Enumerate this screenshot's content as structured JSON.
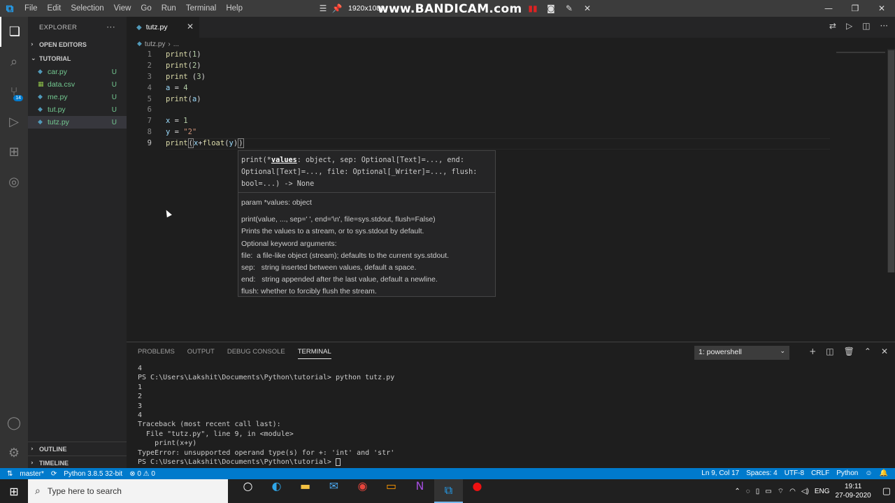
{
  "titlebar": {
    "menu": [
      "File",
      "Edit",
      "Selection",
      "View",
      "Go",
      "Run",
      "Terminal",
      "Help"
    ],
    "recorder_resolution": "1920x1080",
    "recorder_brand": "www.BANDICAM.com"
  },
  "activity_bar": {
    "scm_badge": "14"
  },
  "sidebar": {
    "title": "EXPLORER",
    "open_editors": "OPEN EDITORS",
    "folder": "TUTORIAL",
    "files": [
      {
        "name": "car.py",
        "status": "U",
        "icon": "python-icon"
      },
      {
        "name": "data.csv",
        "status": "U",
        "icon": "csv-icon"
      },
      {
        "name": "me.py",
        "status": "U",
        "icon": "python-icon"
      },
      {
        "name": "tut.py",
        "status": "U",
        "icon": "python-icon"
      },
      {
        "name": "tutz.py",
        "status": "U",
        "icon": "python-icon"
      }
    ],
    "outline": "OUTLINE",
    "timeline": "TIMELINE"
  },
  "editor": {
    "tab_label": "tutz.py",
    "breadcrumb_file": "tutz.py",
    "breadcrumb_more": "...",
    "line_numbers": [
      "1",
      "2",
      "3",
      "4",
      "5",
      "6",
      "7",
      "8",
      "9"
    ],
    "lines": [
      "print(1)",
      "print(2)",
      "print (3)",
      "a = 4",
      "print(a)",
      "",
      "x = 1",
      "y = \"2\"",
      "print(x+float(y))"
    ]
  },
  "hover": {
    "sig_start": "print(*",
    "sig_param": "values",
    "sig_rest": ": object, sep: Optional[Text]=..., end:\nOptional[Text]=..., file: Optional[_Writer]=..., flush:\nbool=...) -> None",
    "param": "param *values: object",
    "doc": [
      "print(value, ..., sep=' ', end='\\n', file=sys.stdout, flush=False)",
      "Prints the values to a stream, or to sys.stdout by default.",
      "Optional keyword arguments:",
      "file:  a file-like object (stream); defaults to the current sys.stdout.",
      "sep:   string inserted between values, default a space.",
      "end:   string appended after the last value, default a newline.",
      "flush: whether to forcibly flush the stream."
    ]
  },
  "panel": {
    "tabs": [
      "PROBLEMS",
      "OUTPUT",
      "DEBUG CONSOLE",
      "TERMINAL"
    ],
    "shell": "1: powershell",
    "terminal": "4\nPS C:\\Users\\Lakshit\\Documents\\Python\\tutorial> python tutz.py\n1\n2\n3\n4\nTraceback (most recent call last):\n  File \"tutz.py\", line 9, in <module>\n    print(x+y)\nTypeError: unsupported operand type(s) for +: 'int' and 'str'\nPS C:\\Users\\Lakshit\\Documents\\Python\\tutorial> "
  },
  "statusbar": {
    "branch": "master*",
    "python": "Python 3.8.5 32-bit",
    "errors": "⊗ 0 ⚠ 0",
    "position": "Ln 9, Col 17",
    "spaces": "Spaces: 4",
    "encoding": "UTF-8",
    "eol": "CRLF",
    "language": "Python"
  },
  "taskbar": {
    "search_placeholder": "Type here to search",
    "lang": "ENG",
    "time": "19:11",
    "date": "27-09-2020"
  }
}
